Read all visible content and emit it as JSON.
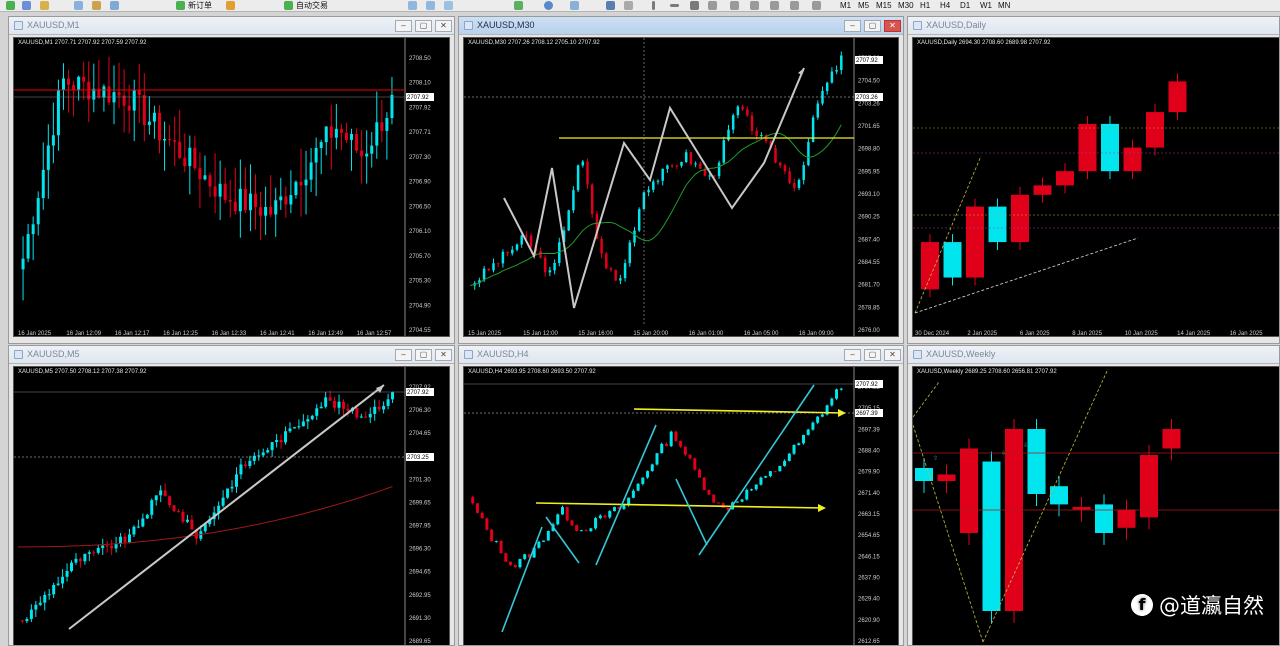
{
  "toolbar": {
    "new_order_label": "新订单",
    "autotrade_label": "自动交易",
    "timeframes": [
      "M1",
      "M5",
      "M15",
      "M30",
      "H1",
      "H4",
      "D1",
      "W1",
      "MN"
    ]
  },
  "colors": {
    "bull": "#00e5ee",
    "bear": "#e0001a",
    "axis_text": "#cfcfcf",
    "yellow_line": "#f0f020",
    "arrow_gray": "#c8c8c8",
    "ma_green": "#1f9c2a",
    "ma_red": "#a01818"
  },
  "watermark": {
    "icon": "facebook-icon",
    "text": "@道瀛自然"
  },
  "windows": [
    {
      "id": "m1",
      "title": "XAUUSD,M1",
      "info": "XAUUSD,M1  2707.71 2707.92 2707.59 2707.92",
      "active": false,
      "price_labels": [
        "2708.50",
        "2708.10",
        "2707.92",
        "2707.71",
        "2707.30",
        "2706.90",
        "2706.50",
        "2706.10",
        "2705.70",
        "2705.30",
        "2704.90",
        "2704.55"
      ],
      "time_labels": [
        "16 Jan 2025",
        "16 Jan 12:09",
        "16 Jan 12:17",
        "16 Jan 12:25",
        "16 Jan 12:33",
        "16 Jan 12:41",
        "16 Jan 12:49",
        "16 Jan 12:57"
      ],
      "current_price": "2707.92"
    },
    {
      "id": "m30",
      "title": "XAUUSD,M30",
      "info": "XAUUSD,M30  2707.26 2708.12 2705.10 2707.92",
      "active": true,
      "price_labels": [
        "2707.92",
        "2704.50",
        "2703.26",
        "2701.65",
        "2698.80",
        "2695.95",
        "2693.10",
        "2690.25",
        "2687.40",
        "2684.55",
        "2681.70",
        "2678.85",
        "2676.00"
      ],
      "time_labels": [
        "15 Jan 2025",
        "15 Jan 12:00",
        "15 Jan 16:00",
        "15 Jan 20:00",
        "16 Jan 01:00",
        "16 Jan 05:00",
        "16 Jan 09:00"
      ],
      "current_price": "2707.92",
      "ref_price": "2703.26"
    },
    {
      "id": "daily",
      "title": "XAUUSD,Daily",
      "info": "XAUUSD,Daily  2694.30 2708.60 2689.98 2707.92",
      "active": false,
      "price_labels": [],
      "time_labels": [
        "30 Dec 2024",
        "2 Jan 2025",
        "6 Jan 2025",
        "8 Jan 2025",
        "10 Jan 2025",
        "14 Jan 2025",
        "16 Jan 2025"
      ]
    },
    {
      "id": "m5",
      "title": "XAUUSD,M5",
      "info": "XAUUSD,M5  2707.50 2708.12 2707.38 2707.92",
      "active": false,
      "price_labels": [
        "2707.92",
        "2706.30",
        "2704.65",
        "2703.25",
        "2701.30",
        "2699.65",
        "2697.95",
        "2696.30",
        "2694.65",
        "2692.95",
        "2691.30",
        "2689.65"
      ],
      "time_labels": [],
      "current_price": "2707.92",
      "ref_price": "2703.25"
    },
    {
      "id": "h4",
      "title": "XAUUSD,H4",
      "info": "XAUUSD,H4  2693.95 2708.60 2693.50 2707.92",
      "active": false,
      "price_labels": [
        "2707.92",
        "2705.15",
        "2697.39",
        "2688.40",
        "2679.90",
        "2671.40",
        "2663.15",
        "2654.65",
        "2646.15",
        "2637.90",
        "2629.40",
        "2620.90",
        "2612.65"
      ],
      "time_labels": [],
      "current_price": "2707.92",
      "ref_price": "2697.39"
    },
    {
      "id": "weekly",
      "title": "XAUUSD,Weekly",
      "info": "XAUUSD,Weekly  2689.25 2708.60 2656.81 2707.92",
      "active": false,
      "price_labels": [],
      "time_labels": []
    }
  ]
}
